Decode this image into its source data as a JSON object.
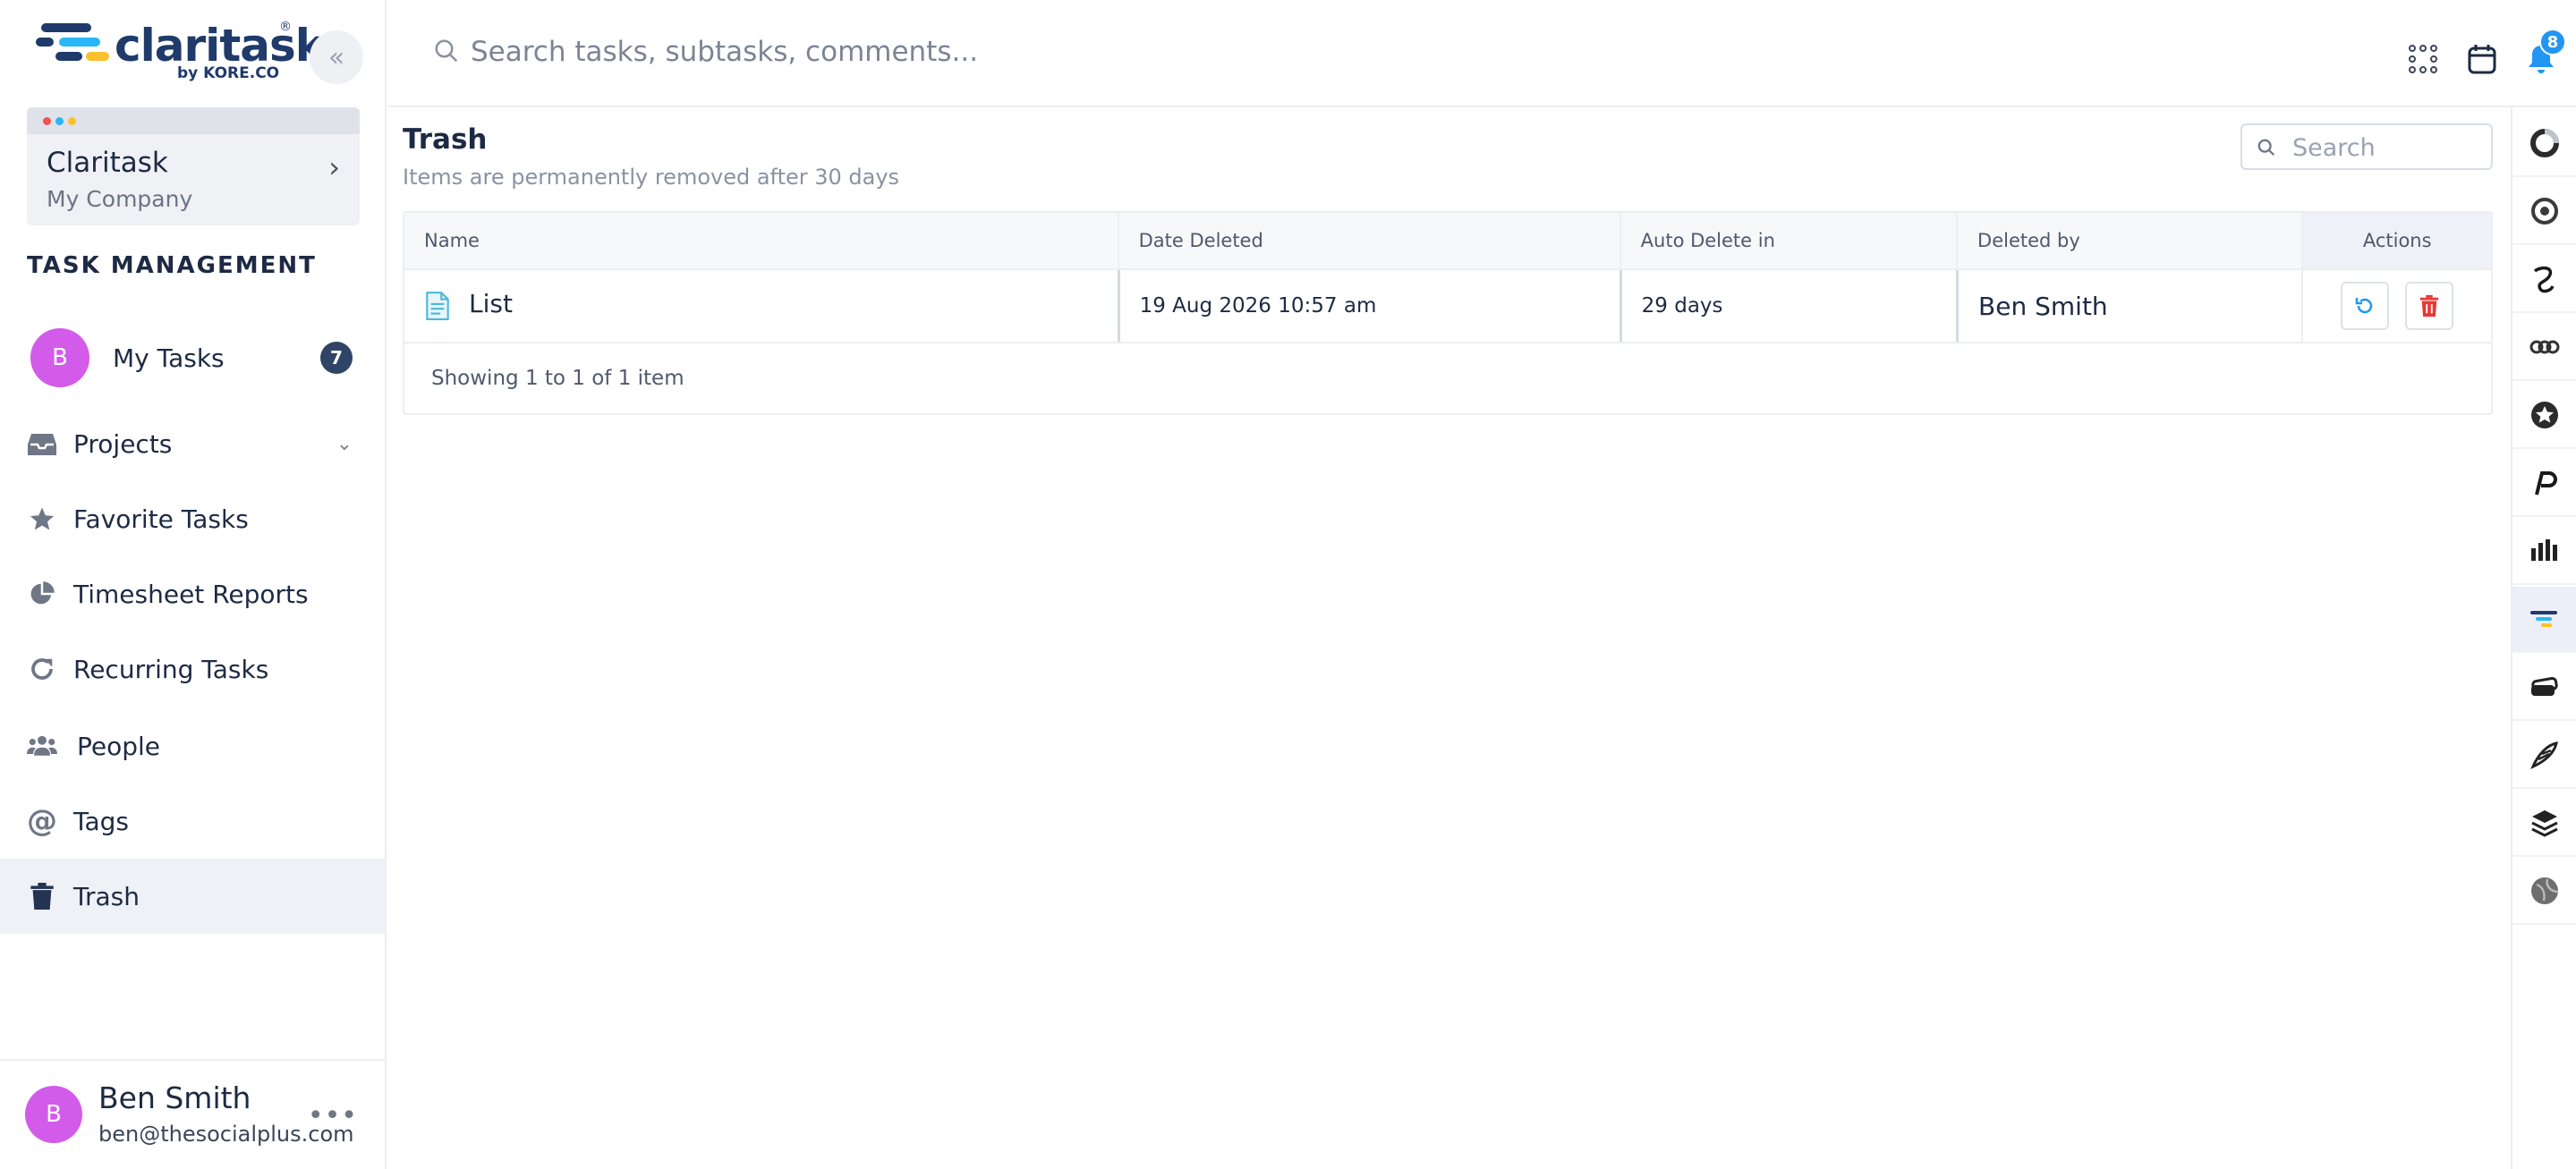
{
  "app": {
    "brand": "claritask",
    "brand_by": "by KORE.CO",
    "brand_reg": "®"
  },
  "workspace": {
    "name": "Claritask",
    "company": "My Company"
  },
  "sidebar": {
    "section_title": "TASK MANAGEMENT",
    "my_tasks": {
      "avatar": "B",
      "label": "My Tasks",
      "count": "7"
    },
    "items": [
      {
        "label": "Projects",
        "icon": "inbox-icon"
      },
      {
        "label": "Favorite Tasks",
        "icon": "star-icon"
      },
      {
        "label": "Timesheet Reports",
        "icon": "pie-chart-icon"
      },
      {
        "label": "Recurring Tasks",
        "icon": "refresh-icon"
      },
      {
        "label": "People",
        "icon": "users-icon"
      },
      {
        "label": "Tags",
        "icon": "at-icon"
      },
      {
        "label": "Trash",
        "icon": "trash-icon",
        "active": true
      }
    ]
  },
  "user": {
    "avatar": "B",
    "name": "Ben Smith",
    "email": "ben@thesocialplus.com"
  },
  "topbar": {
    "search_placeholder": "Search tasks, subtasks, comments...",
    "notification_count": "8"
  },
  "page": {
    "title": "Trash",
    "subtitle": "Items are permanently removed after 30 days",
    "search_placeholder": "Search"
  },
  "table": {
    "columns": [
      "Name",
      "Date Deleted",
      "Auto Delete in",
      "Deleted by",
      "Actions"
    ],
    "rows": [
      {
        "name": "List",
        "date_deleted": "19 Aug 2026 10:57 am",
        "auto_delete": "29 days",
        "deleted_by": "Ben Smith"
      }
    ],
    "footer": "Showing 1 to 1 of 1 item"
  },
  "colors": {
    "accent": "#2196f3",
    "avatar": "#d35bea",
    "badge": "#2f4467",
    "delete": "#e53935"
  }
}
